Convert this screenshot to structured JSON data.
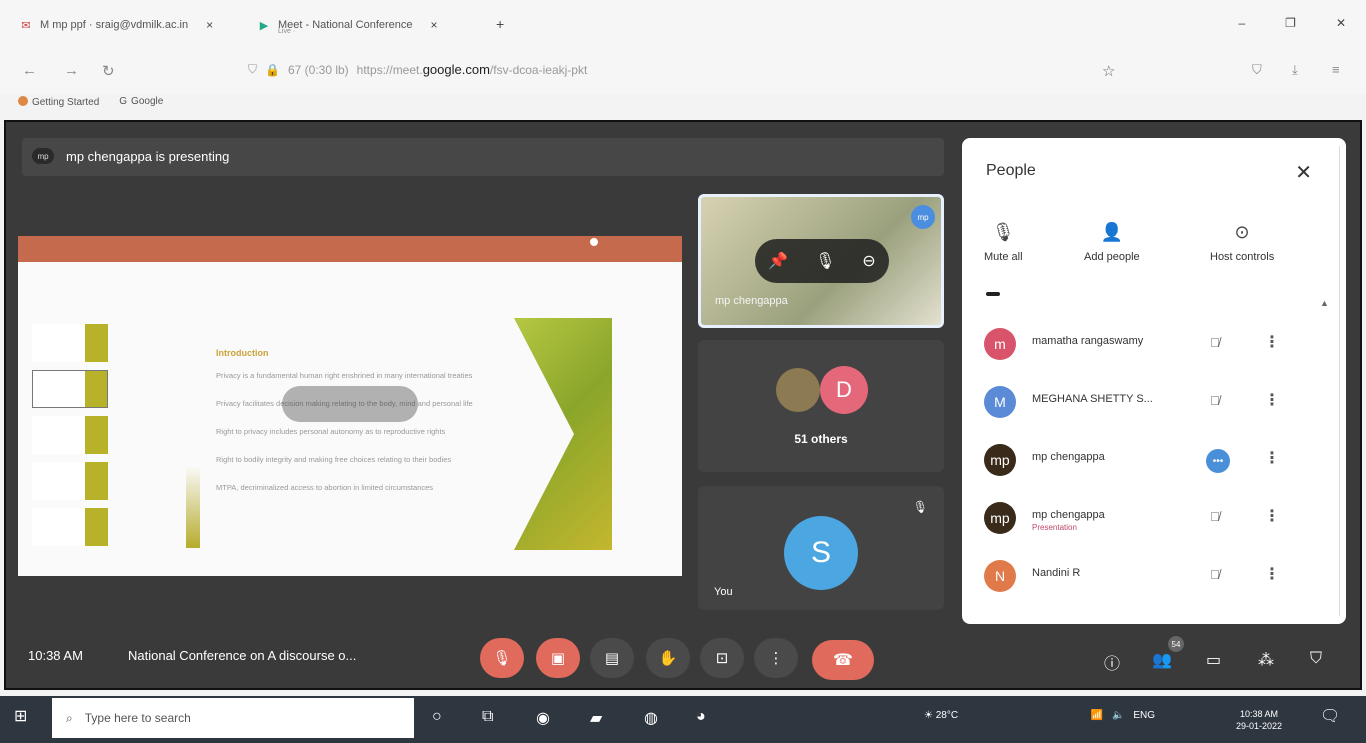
{
  "browser": {
    "tabs": [
      {
        "label": "M mp ppf · sraig@vdmilk.ac.in",
        "close": "×"
      },
      {
        "label": "Meet - National Conference",
        "sub": "Live ·",
        "close": "×"
      }
    ],
    "new_tab": "+",
    "window": {
      "minimize": "–",
      "maximize": "❐",
      "close": "✕"
    },
    "url_prefix": "67 (0:30 lb)",
    "url_scheme": "https://meet.",
    "url_domain": "google.com",
    "url_path": "/fsv-dcoa-ieakj-pkt",
    "bookmarks": [
      "Getting Started",
      "Google"
    ]
  },
  "meet": {
    "presenting_chip": "mp",
    "presenting_text": "mp chengappa is presenting",
    "slide": {
      "title": "Introduction",
      "bullets": [
        "Privacy is a fundamental human right enshrined in many international treaties",
        "Privacy facilitates decision making relating to the body, mind and personal life",
        "Right to privacy includes personal autonomy as to reproductive rights",
        "Right to bodily integrity and making free choices relating to their bodies",
        "MTPA, decriminalized access to abortion in limited circumstances"
      ]
    },
    "self_tile": {
      "name": "mp chengappa",
      "badge": "mp",
      "pin_icon": "📌",
      "mic_icon": "🎙",
      "remove_icon": "⊖"
    },
    "others_tile": {
      "avatar_letter": "D",
      "label": "51 others"
    },
    "you_tile": {
      "avatar_letter": "S",
      "label": "You",
      "mic_icon": "🎙"
    },
    "people": {
      "title": "People",
      "actions": [
        {
          "label": "Mute all",
          "icon": "🎙"
        },
        {
          "label": "Add people",
          "icon": "👤"
        },
        {
          "label": "Host controls",
          "icon": "⊙"
        }
      ],
      "list": [
        {
          "initials": "m",
          "name": "mamatha rangaswamy",
          "role": "",
          "color": "#d9536b",
          "state": "muted"
        },
        {
          "initials": "M",
          "name": "MEGHANA SHETTY S...",
          "role": "",
          "color": "#5b8bd6",
          "state": "muted"
        },
        {
          "initials": "mp",
          "name": "mp chengappa",
          "role": "",
          "color": "#3a2a1a",
          "state": "speaking"
        },
        {
          "initials": "mp",
          "name": "mp chengappa",
          "role": "Presentation",
          "color": "#3a2a1a",
          "state": "muted"
        },
        {
          "initials": "N",
          "name": "Nandini R",
          "role": "",
          "color": "#e07a4a",
          "state": "muted"
        }
      ]
    },
    "bottom": {
      "time": "10:38 AM",
      "meeting_name": "National Conference on A discourse o...",
      "participants_count": "54"
    }
  },
  "taskbar": {
    "search_placeholder": "Type here to search",
    "weather": "28°C",
    "lang": "ENG",
    "time": "10:38 AM",
    "date": "29-01-2022"
  }
}
